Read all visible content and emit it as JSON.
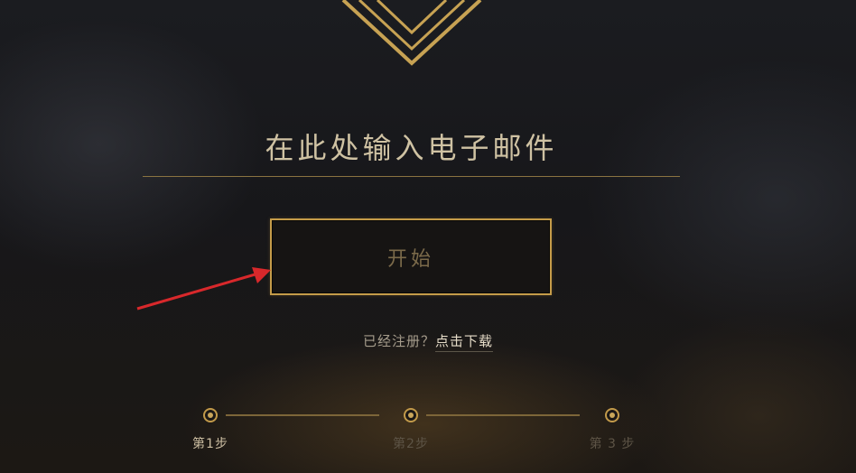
{
  "email": {
    "placeholder": "在此处输入电子邮件",
    "value": ""
  },
  "start_button": {
    "label": "开始"
  },
  "register": {
    "prompt": "已经注册？",
    "link": "点击下载"
  },
  "steps": [
    {
      "label": "第1步",
      "active": true
    },
    {
      "label": "第2步",
      "active": false
    },
    {
      "label": "第 3 步",
      "active": false
    }
  ],
  "colors": {
    "gold": "#c59c49",
    "annotation_arrow": "#d8282b"
  }
}
